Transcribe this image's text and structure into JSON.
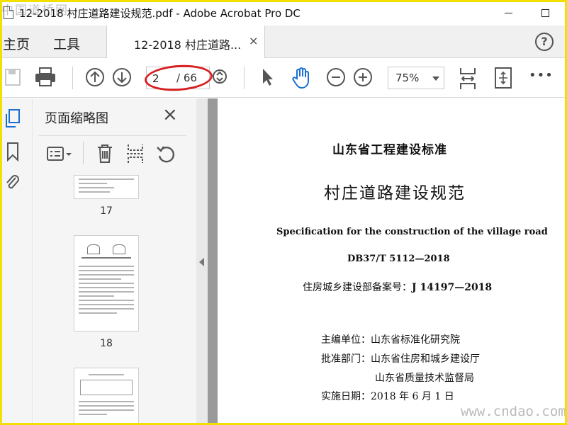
{
  "window": {
    "title": "12-2018 村庄道路建设规范.pdf - Adobe Acrobat Pro DC"
  },
  "watermarks": {
    "top": "中国道桥网",
    "bottom": "www.cndao.com"
  },
  "tabs": {
    "home": "主页",
    "tools": "工具",
    "document": "12-2018 村庄道路...",
    "close_symbol": "×",
    "help_symbol": "?"
  },
  "toolbar": {
    "current_page": "2",
    "total_pages": "/ 66",
    "zoom": "75%",
    "more_symbol": "•••"
  },
  "thumbnail_panel": {
    "title": "页面缩略图",
    "close_symbol": "×",
    "thumbnails": [
      {
        "label": "17"
      },
      {
        "label": "18"
      }
    ]
  },
  "document": {
    "org_header": "山东省工程建设标准",
    "title": "村庄道路建设规范",
    "english_title": "Specification for the construction of the village road",
    "standard_code": "DB37/T 5112—2018",
    "filing_prefix": "住房城乡建设部备案号：",
    "filing_number": "J 14197—2018",
    "editor_line": "主编单位：山东省标准化研究院",
    "approver_line": "批准部门：山东省住房和城乡建设厅",
    "approver_line_2": "山东省质量技术监督局",
    "effective_line": "实施日期：2018 年 6 月 1 日"
  },
  "colors": {
    "accent_blue": "#1a6fd0",
    "annotation_red": "#d82020",
    "highlight_frame": "#f2e000"
  }
}
